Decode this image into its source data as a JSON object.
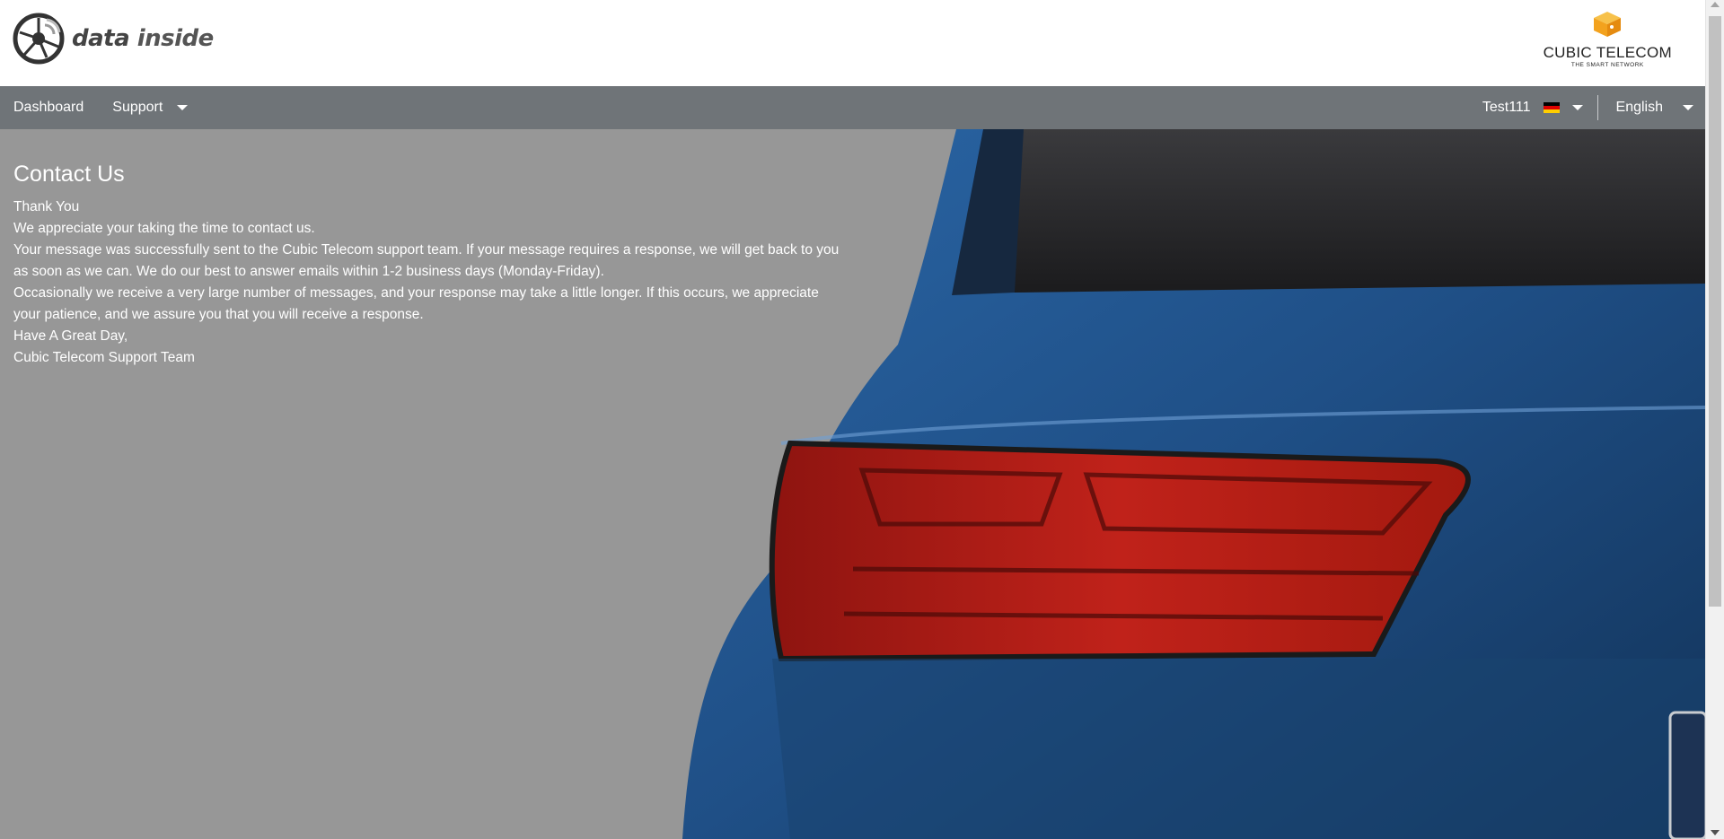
{
  "header": {
    "logo_text_bold": "data",
    "logo_text_rest": " inside",
    "brand_name": "CUBIC TELECOM",
    "brand_tagline": "THE SMART NETWORK"
  },
  "nav": {
    "dashboard": "Dashboard",
    "support": "Support",
    "user": "Test111",
    "language": "English"
  },
  "icons": {
    "logo": "wheel-signal-icon",
    "brand": "cube-icon",
    "flag": "germany-flag-icon",
    "caret": "chevron-down-icon"
  },
  "colors": {
    "nav_bg": "#6f7478",
    "content_bg": "#979797",
    "car_blue": "#1f4f86",
    "taillight_red": "#c0221a",
    "brand_orange": "#f3a21d"
  },
  "content": {
    "title": "Contact Us",
    "lines": [
      "Thank You",
      "We appreciate your taking the time to contact us.",
      "Your message was successfully sent to the Cubic Telecom support team. If your message requires a response, we will get back to you as soon as we can. We do our best to answer emails within 1-2 business days (Monday-Friday).",
      "Occasionally we receive a very large number of messages, and your response may take a little longer. If this occurs, we appreciate your patience, and we assure you that you will receive a response.",
      "Have A Great Day,",
      "Cubic Telecom Support Team"
    ]
  }
}
